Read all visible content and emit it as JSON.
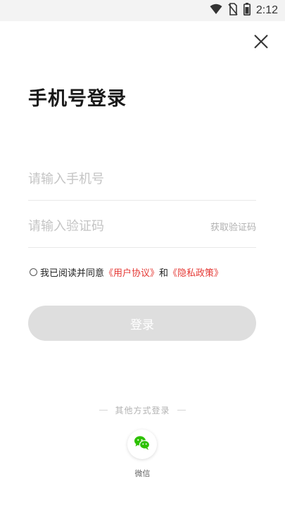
{
  "status_bar": {
    "time": "2:12",
    "icons": [
      "wifi-icon",
      "no-sim-icon",
      "battery-icon"
    ]
  },
  "header": {
    "close_icon": "close-icon"
  },
  "title": "手机号登录",
  "phone_field": {
    "value": "",
    "placeholder": "请输入手机号"
  },
  "code_field": {
    "value": "",
    "placeholder": "请输入验证码",
    "get_code_label": "获取验证码"
  },
  "agreement": {
    "checked": false,
    "prefix": "我已阅读并同意",
    "user_agreement": "《用户协议》",
    "conjunction": "和",
    "privacy_policy": "《隐私政策》"
  },
  "login_button": {
    "label": "登录",
    "enabled": false
  },
  "other_methods": {
    "label": "其他方式登录",
    "options": [
      {
        "label": "微信",
        "icon": "wechat-icon"
      }
    ]
  },
  "colors": {
    "link": "#e53935",
    "wechat": "#2dc100",
    "button_disabled": "#dedede"
  }
}
